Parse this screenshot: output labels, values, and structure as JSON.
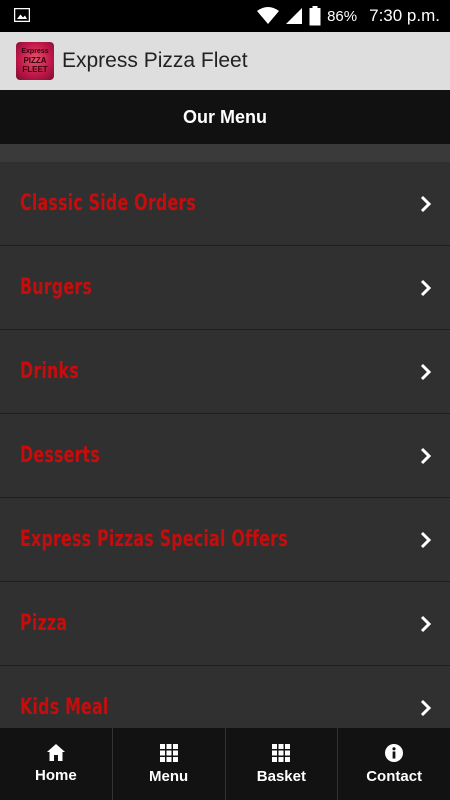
{
  "status_bar": {
    "battery": "86%",
    "time": "7:30 p.m."
  },
  "app_bar": {
    "title": "Express Pizza Fleet",
    "logo_text": [
      "Express",
      "PIZZA",
      "FLEET"
    ]
  },
  "page_header": {
    "title": "Our Menu"
  },
  "menu": {
    "items": [
      {
        "label": "Classic Side Orders"
      },
      {
        "label": "Burgers"
      },
      {
        "label": "Drinks"
      },
      {
        "label": "Desserts"
      },
      {
        "label": "Express Pizzas Special Offers"
      },
      {
        "label": "Pizza"
      },
      {
        "label": "Kids Meal"
      }
    ]
  },
  "bottom_nav": {
    "items": [
      {
        "label": "Home",
        "icon": "home-icon"
      },
      {
        "label": "Menu",
        "icon": "grid-icon"
      },
      {
        "label": "Basket",
        "icon": "grid-icon"
      },
      {
        "label": "Contact",
        "icon": "info-icon"
      }
    ]
  },
  "colors": {
    "menu_label": "#c60d0d",
    "background": "#2f2f2f",
    "header": "#111111",
    "app_bar": "#dedede"
  }
}
